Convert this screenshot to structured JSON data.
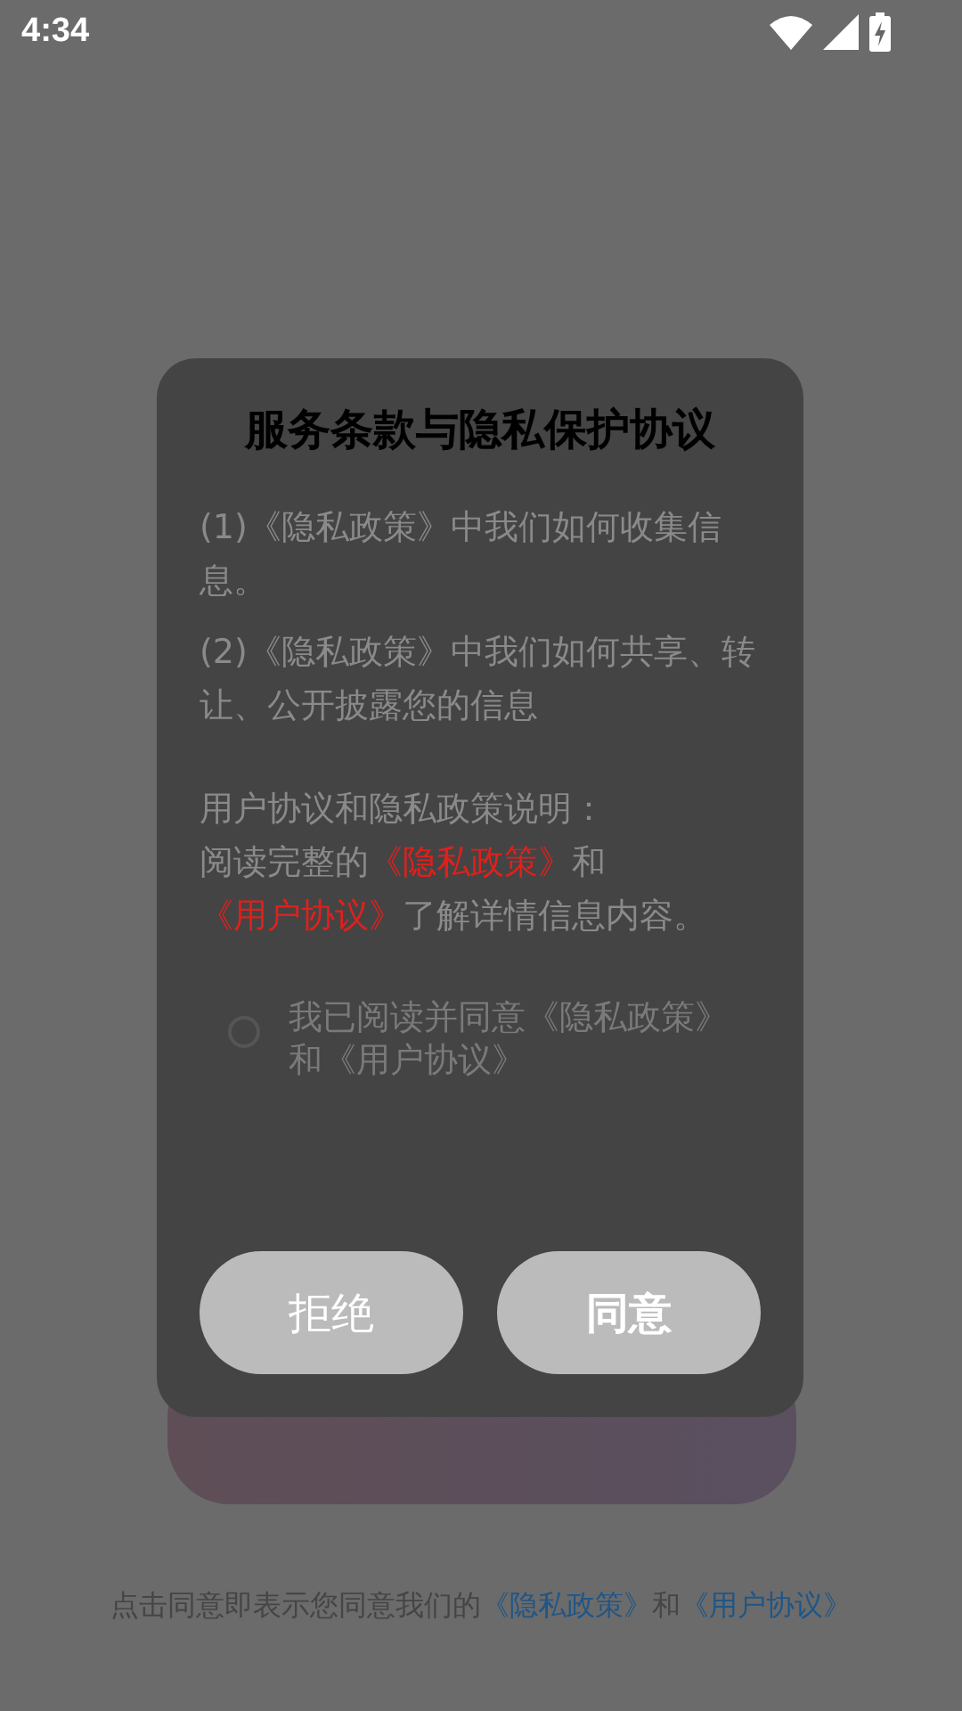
{
  "status_bar": {
    "time": "4:34"
  },
  "footer": {
    "parts": [
      {
        "kind": "text",
        "text": "点击同意即表示您同意我们的"
      },
      {
        "kind": "link",
        "text": "《隐私政策》"
      },
      {
        "kind": "text",
        "text": "和"
      },
      {
        "kind": "link",
        "text": "《用户协议》"
      }
    ]
  },
  "dialog": {
    "title": "服务条款与隐私保护协议",
    "items": [
      "(1)《隐私政策》中我们如何收集信息。",
      "(2)《隐私政策》中我们如何共享、转让、公开披露您的信息"
    ],
    "heading": "用户协议和隐私政策说明：",
    "notice": [
      {
        "kind": "text",
        "text": "阅读完整的"
      },
      {
        "kind": "link",
        "text": "《隐私政策》"
      },
      {
        "kind": "text",
        "text": "和"
      },
      {
        "kind": "link",
        "text": "《用户协议》"
      },
      {
        "kind": "text",
        "text": "了解详情信息内容。"
      }
    ],
    "consent": {
      "text": "我已阅读并同意《隐私政策》和《用户协议》",
      "checked": false
    },
    "buttons": [
      {
        "label": "拒绝",
        "kind": "reject"
      },
      {
        "label": "同意",
        "kind": "accept"
      }
    ]
  }
}
